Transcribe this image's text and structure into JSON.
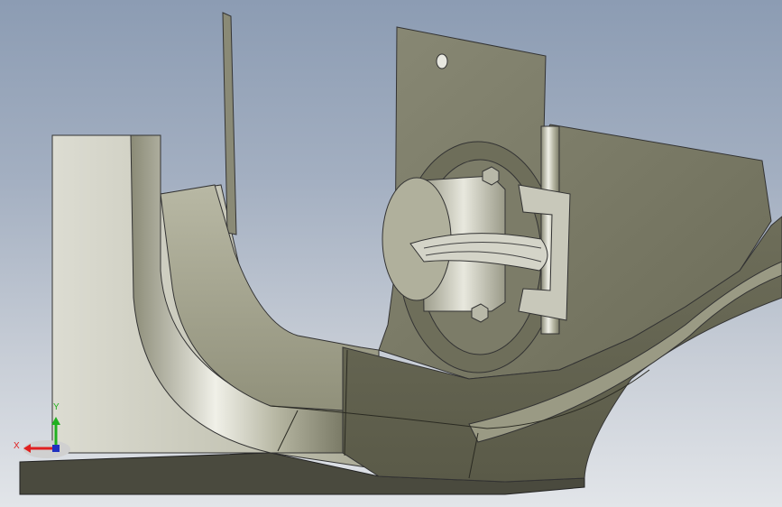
{
  "viewport": {
    "background_top": "#8c9cb3",
    "background_bottom": "#e2e5e9",
    "model_color": "#7a7a66"
  },
  "triad": {
    "x_label": "X",
    "y_label": "Y",
    "x_color": "#e02020",
    "y_color": "#20b020",
    "z_color": "#2030c0",
    "icon": "coordinate-triad-icon"
  }
}
